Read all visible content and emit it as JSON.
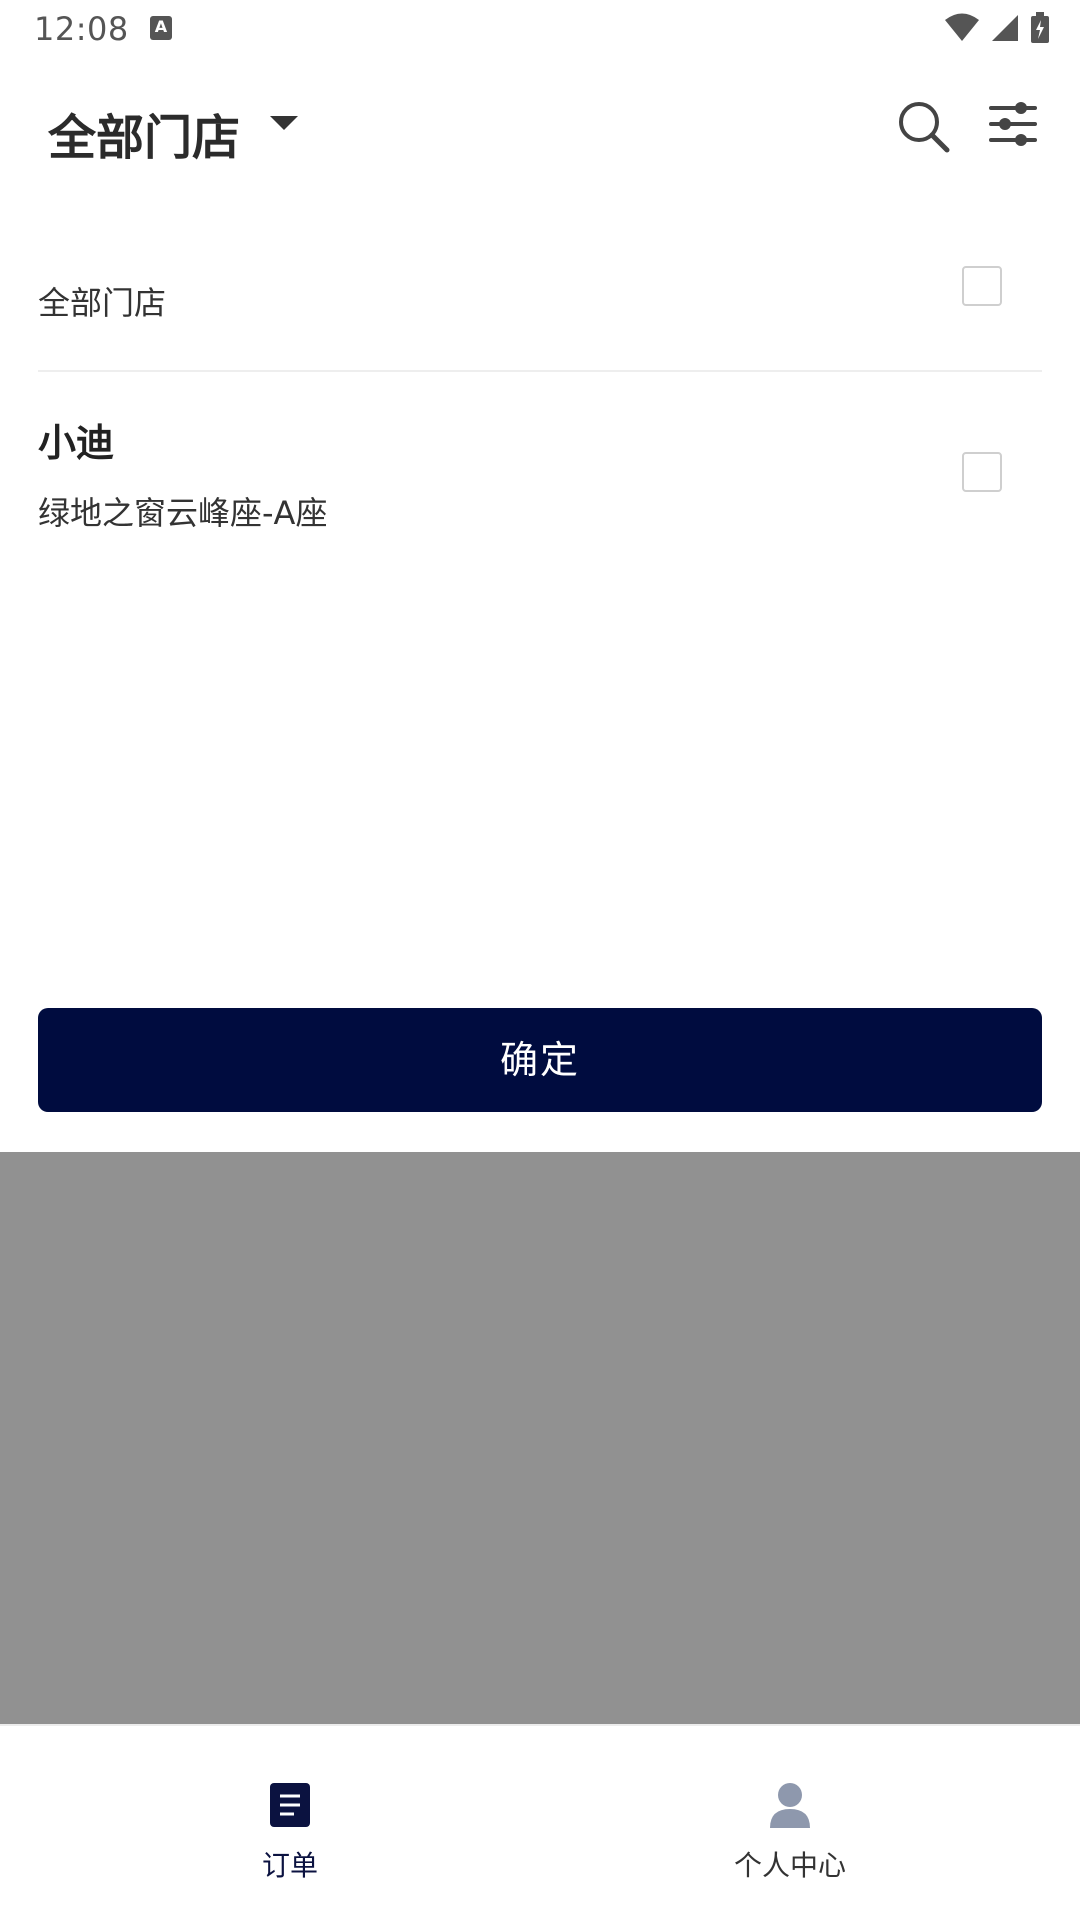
{
  "status_bar": {
    "time": "12:08",
    "notification_icon": "A",
    "icons": [
      "wifi-icon",
      "signal-icon",
      "battery-icon"
    ]
  },
  "header": {
    "title": "全部门店",
    "icons": [
      "search-icon",
      "filter-icon"
    ]
  },
  "store_list": {
    "all_option": {
      "label": "全部门店",
      "checked": false
    },
    "stores": [
      {
        "name": "小迪",
        "address": "绿地之窗云峰座-A座",
        "checked": false
      }
    ]
  },
  "confirm_button": {
    "label": "确定"
  },
  "bottom_nav": {
    "items": [
      {
        "label": "订单",
        "icon": "orders-icon",
        "active": true
      },
      {
        "label": "个人中心",
        "icon": "user-icon",
        "active": false
      }
    ]
  },
  "colors": {
    "primary": "#000c3f",
    "overlay": "#919191",
    "divider": "#eeeeee",
    "checkbox_border": "#cfcfcf"
  }
}
